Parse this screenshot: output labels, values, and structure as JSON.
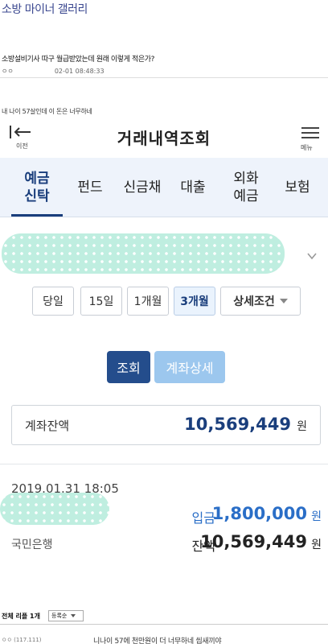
{
  "gallery": {
    "title": "소방 마이너 갤러리"
  },
  "post": {
    "title": "소방설비기사 따구 월급받았는데 원래 이렇게 적은가?",
    "author": "ㅇㅇ",
    "datetime": "02-01 08:48:33",
    "body": "내 나이 57살인데 이 돈은 너무하네"
  },
  "app": {
    "back_label": "이전",
    "title": "거래내역조회",
    "menu_label": "메뉴",
    "tabs": [
      {
        "label": "예금\n신탁",
        "active": true
      },
      {
        "label": "펀드",
        "active": false
      },
      {
        "label": "신금채",
        "active": false
      },
      {
        "label": "대출",
        "active": false
      },
      {
        "label": "외화\n예금",
        "active": false
      },
      {
        "label": "보험",
        "active": false
      }
    ],
    "period_buttons": [
      "당일",
      "15일",
      "1개월",
      "3개월"
    ],
    "selected_period": "3개월",
    "detail_filter_label": "상세조건",
    "search_button": "조회",
    "account_detail_button": "계좌상세",
    "balance": {
      "label": "계좌잔액",
      "amount": "10,569,449",
      "unit": "원"
    },
    "transaction": {
      "datetime": "2019.01.31 18:05",
      "type_label": "입금",
      "amount": "1,800,000",
      "unit": "원",
      "bank": "국민은행",
      "balance_label": "잔액",
      "balance_amount": "10,569,449",
      "balance_unit": "원"
    },
    "colors": {
      "primary": "#244d8c",
      "secondary": "#9cc7ee",
      "deposit": "#2a6ec7",
      "tab_bg": "#eef3fb"
    }
  },
  "comments": {
    "header": "전체 리플 1개",
    "sort_option": "등록순",
    "items": [
      {
        "user": "ㅇㅇ (117.111)",
        "text": "니나이 57에 천만원이 더 너무하네 씹새끼야"
      }
    ]
  }
}
